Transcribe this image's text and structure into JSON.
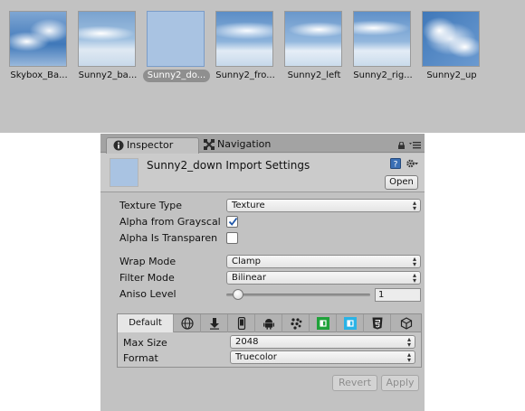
{
  "project_browser": {
    "assets": [
      {
        "name": "Skybox_Ba...",
        "icon": "skybox-texture"
      },
      {
        "name": "Sunny2_ba...",
        "icon": "skybox-texture"
      },
      {
        "name": "Sunny2_do...",
        "icon": "skybox-texture",
        "selected": true
      },
      {
        "name": "Sunny2_fro...",
        "icon": "skybox-texture"
      },
      {
        "name": "Sunny2_left",
        "icon": "skybox-texture"
      },
      {
        "name": "Sunny2_rig...",
        "icon": "skybox-texture"
      },
      {
        "name": "Sunny2_up",
        "icon": "skybox-texture"
      }
    ]
  },
  "inspector": {
    "tabs": [
      {
        "label": "Inspector",
        "icon": "info-icon",
        "active": true
      },
      {
        "label": "Navigation",
        "icon": "navigation-icon",
        "active": false
      }
    ],
    "header": {
      "title": "Sunny2_down Import Settings",
      "open_label": "Open"
    },
    "fields": {
      "texture_type_label": "Texture Type",
      "texture_type_value": "Texture",
      "alpha_from_grayscale_label": "Alpha from Grayscal",
      "alpha_from_grayscale_checked": true,
      "alpha_is_transparency_label": "Alpha Is Transparen",
      "alpha_is_transparency_checked": false,
      "wrap_mode_label": "Wrap Mode",
      "wrap_mode_value": "Clamp",
      "filter_mode_label": "Filter Mode",
      "filter_mode_value": "Bilinear",
      "aniso_level_label": "Aniso Level",
      "aniso_level_value": "1",
      "aniso_level_slider_fraction": 0.0
    },
    "platform": {
      "tabs": [
        {
          "label": "Default",
          "icon": "",
          "active": true
        },
        {
          "label": "",
          "icon": "web-icon"
        },
        {
          "label": "",
          "icon": "standalone-download-icon"
        },
        {
          "label": "",
          "icon": "iphone-icon"
        },
        {
          "label": "",
          "icon": "android-icon"
        },
        {
          "label": "",
          "icon": "blackberry-icon"
        },
        {
          "label": "",
          "icon": "windows-store-green-icon"
        },
        {
          "label": "",
          "icon": "windows-phone-blue-icon"
        },
        {
          "label": "",
          "icon": "html5-icon"
        },
        {
          "label": "",
          "icon": "console-cube-icon"
        }
      ],
      "max_size_label": "Max Size",
      "max_size_value": "2048",
      "format_label": "Format",
      "format_value": "Truecolor"
    },
    "buttons": {
      "revert_label": "Revert",
      "apply_label": "Apply"
    }
  },
  "colors": {
    "panel_bg": "#c2c2c2",
    "selection": "#8f8f8f",
    "windows_green": "#1fa23a",
    "windows_blue": "#2ab3e6"
  }
}
